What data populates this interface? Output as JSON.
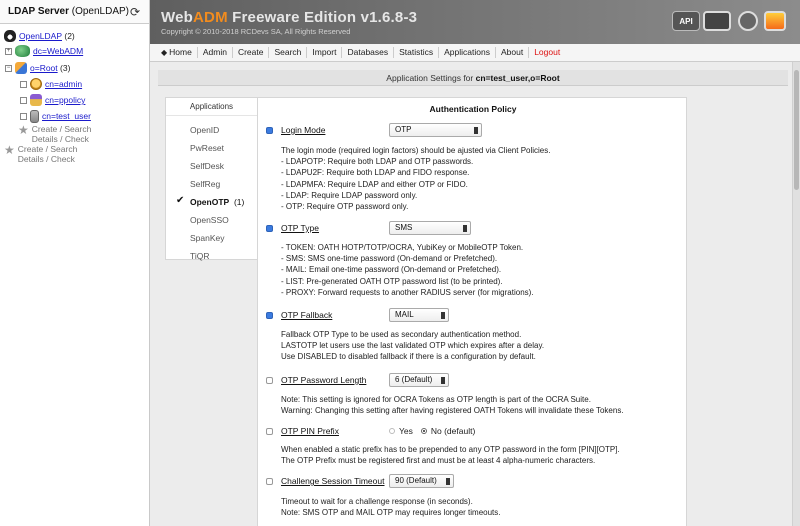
{
  "left_panel": {
    "title": "LDAP Server",
    "title_sub": "(OpenLDAP)",
    "tree": {
      "root_label": "OpenLDAP",
      "root_count": "(2)",
      "dc_label": "dc=WebADM",
      "org_label": "o=Root",
      "org_count": "(3)",
      "children": [
        "cn=admin",
        "cn=ppolicy",
        "cn=test_user"
      ],
      "action1_a": "Create / Search",
      "action1_b": "Details / Check",
      "action2_a": "Create / Search",
      "action2_b": "Details / Check"
    }
  },
  "header": {
    "brand_prefix": "Web",
    "brand_accent": "ADM",
    "brand_suffix": " Freeware Edition v1.6.8-3",
    "copyright": "Copyright © 2010-2018 RCDevs SA, All Rights Reserved",
    "api_label": "API"
  },
  "menu": [
    "Home",
    "Admin",
    "Create",
    "Search",
    "Import",
    "Databases",
    "Statistics",
    "Applications",
    "About",
    "Logout"
  ],
  "breadcrumb": {
    "prefix": "Application Settings for ",
    "target": "cn=test_user,o=Root"
  },
  "applications": {
    "heading": "Applications",
    "items": [
      "OpenID",
      "PwReset",
      "SelfDesk",
      "SelfReg",
      "OpenOTP",
      "OpenSSO",
      "SpanKey",
      "TiQR"
    ],
    "active_count": "(1)"
  },
  "policy": {
    "title": "Authentication Policy",
    "login_mode": {
      "label": "Login Mode",
      "value": "OTP",
      "desc": [
        "The login mode (required login factors) should be ajusted via Client Policies.",
        "- LDAPOTP: Require both LDAP and OTP passwords.",
        "- LDAPU2F: Require both LDAP and FIDO response.",
        "- LDAPMFA: Require LDAP and either OTP or FIDO.",
        "- LDAP: Require LDAP password only.",
        "- OTP: Require OTP password only."
      ]
    },
    "otp_type": {
      "label": "OTP Type",
      "value": "SMS",
      "desc": [
        "- TOKEN: OATH HOTP/TOTP/OCRA, YubiKey or MobileOTP Token.",
        "- SMS: SMS one-time password (On-demand or Prefetched).",
        "- MAIL: Email one-time password (On-demand or Prefetched).",
        "- LIST: Pre-generated OATH OTP password list (to be printed).",
        "- PROXY: Forward requests to another RADIUS server (for migrations)."
      ]
    },
    "otp_fallback": {
      "label": "OTP Fallback",
      "value": "MAIL",
      "desc": [
        "Fallback OTP Type to be used as secondary authentication method.",
        "LASTOTP let users use the last validated OTP which expires after a delay.",
        "Use DISABLED to disabled fallback if there is a configuration by default."
      ]
    },
    "otp_length": {
      "label": "OTP Password Length",
      "value": "6 (Default)",
      "desc": [
        "Note: This setting is ignored for OCRA Tokens as OTP length is part of the OCRA Suite.",
        "Warning: Changing this setting after having registered OATH Tokens will invalidate these Tokens."
      ]
    },
    "otp_pin": {
      "label": "OTP PIN Prefix",
      "opt_yes": "Yes",
      "opt_no": "No (default)",
      "desc": [
        "When enabled a static prefix has to be prepended to any OTP password in the form [PIN][OTP].",
        "The OTP Prefix must be registered first and must be at least 4 alpha-numeric characters."
      ]
    },
    "challenge_timeout": {
      "label": "Challenge Session Timeout",
      "value": "90 (Default)",
      "desc": [
        "Timeout to wait for a challenge response (in seconds).",
        "Note: SMS OTP and MAIL OTP may requires longer timeouts."
      ]
    }
  }
}
